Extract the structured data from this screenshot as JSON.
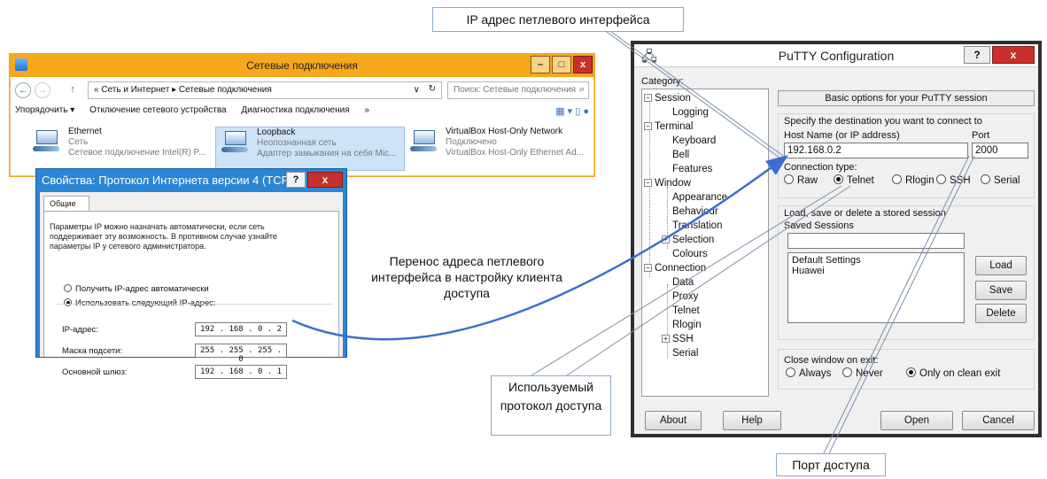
{
  "net_window": {
    "title": "Сетевые подключения",
    "btn_min": "–",
    "btn_max": "□",
    "btn_close": "x",
    "nav_back": "←",
    "nav_fwd": "→",
    "nav_up": "↑",
    "address": "« Сеть и Интернет ▸ Сетевые подключения",
    "address_dropdown": "∨",
    "refresh": "↻",
    "search_placeholder": "Поиск: Сетевые подключения",
    "toolbar": {
      "organize": "Упорядочить ▾",
      "disable_device": "Отключение сетевого устройства",
      "diagnose": "Диагностика подключения",
      "more": "»"
    },
    "adapters": [
      {
        "name": "Ethernet",
        "status": "Сеть",
        "device": "Сетевое подключение Intel(R) P..."
      },
      {
        "name": "Loopback",
        "status": "Неопознанная сеть",
        "device": "Адаптер замыкания на себя Mic..."
      },
      {
        "name": "VirtualBox Host-Only Network",
        "status": "Подключено",
        "device": "VirtualBox Host-Only Ethernet Ad..."
      }
    ]
  },
  "ip_dialog": {
    "title": "Свойства: Протокол Интернета версии 4 (TCP...",
    "help": "?",
    "close": "x",
    "tab": "Общие",
    "description": "Параметры IP можно назначать автоматически, если сеть поддерживает эту возможность. В противном случае узнайте параметры IP у сетевого администратора.",
    "radio_auto": "Получить IP-адрес автоматически",
    "radio_manual": "Использовать следующий IP-адрес:",
    "ip_label": "IP-адрес:",
    "ip_value": "192 . 168 . 0 . 2",
    "mask_label": "Маска подсети:",
    "mask_value": "255 . 255 . 255 . 0",
    "gw_label": "Основной шлюз:",
    "gw_value": "192 . 168 . 0 . 1"
  },
  "putty": {
    "title": "PuTTY Configuration",
    "help": "?",
    "close": "x",
    "category_label": "Category:",
    "tree": {
      "session": "Session",
      "logging": "Logging",
      "terminal": "Terminal",
      "keyboard": "Keyboard",
      "bell": "Bell",
      "features": "Features",
      "window": "Window",
      "appearance": "Appearance",
      "behaviour": "Behaviour",
      "translation": "Translation",
      "selection": "Selection",
      "colours": "Colours",
      "connection": "Connection",
      "data": "Data",
      "proxy": "Proxy",
      "telnet": "Telnet",
      "rlogin": "Rlogin",
      "ssh": "SSH",
      "serial": "Serial"
    },
    "basic_options": "Basic options for your PuTTY session",
    "dest_title": "Specify the destination you want to connect to",
    "host_label": "Host Name (or IP address)",
    "host_value": "192.168.0.2",
    "port_label": "Port",
    "port_value": "2000",
    "conn_type_label": "Connection type:",
    "conn_types": [
      "Raw",
      "Telnet",
      "Rlogin",
      "SSH",
      "Serial"
    ],
    "conn_selected": "Telnet",
    "sess_title": "Load, save or delete a stored session",
    "saved_sessions_label": "Saved Sessions",
    "saved_sessions_value": "",
    "session_list": [
      "Default Settings",
      "Huawei"
    ],
    "btn_load": "Load",
    "btn_save": "Save",
    "btn_delete": "Delete",
    "close_title": "Close window on exit:",
    "close_options": [
      "Always",
      "Never",
      "Only on clean exit"
    ],
    "close_selected": "Only on clean exit",
    "btn_about": "About",
    "btn_help": "Help",
    "btn_open": "Open",
    "btn_cancel": "Cancel"
  },
  "annotations": {
    "ip_callout": "IP адрес петлевого интерфейса",
    "transfer_note": "Перенос адреса петлевого интерфейса в настройку клиента доступа",
    "protocol_callout": "Используемый протокол доступа",
    "port_callout": "Порт доступа",
    "arrow_color": "#3a6fd0",
    "callout_border_color": "#8aa8d0"
  }
}
